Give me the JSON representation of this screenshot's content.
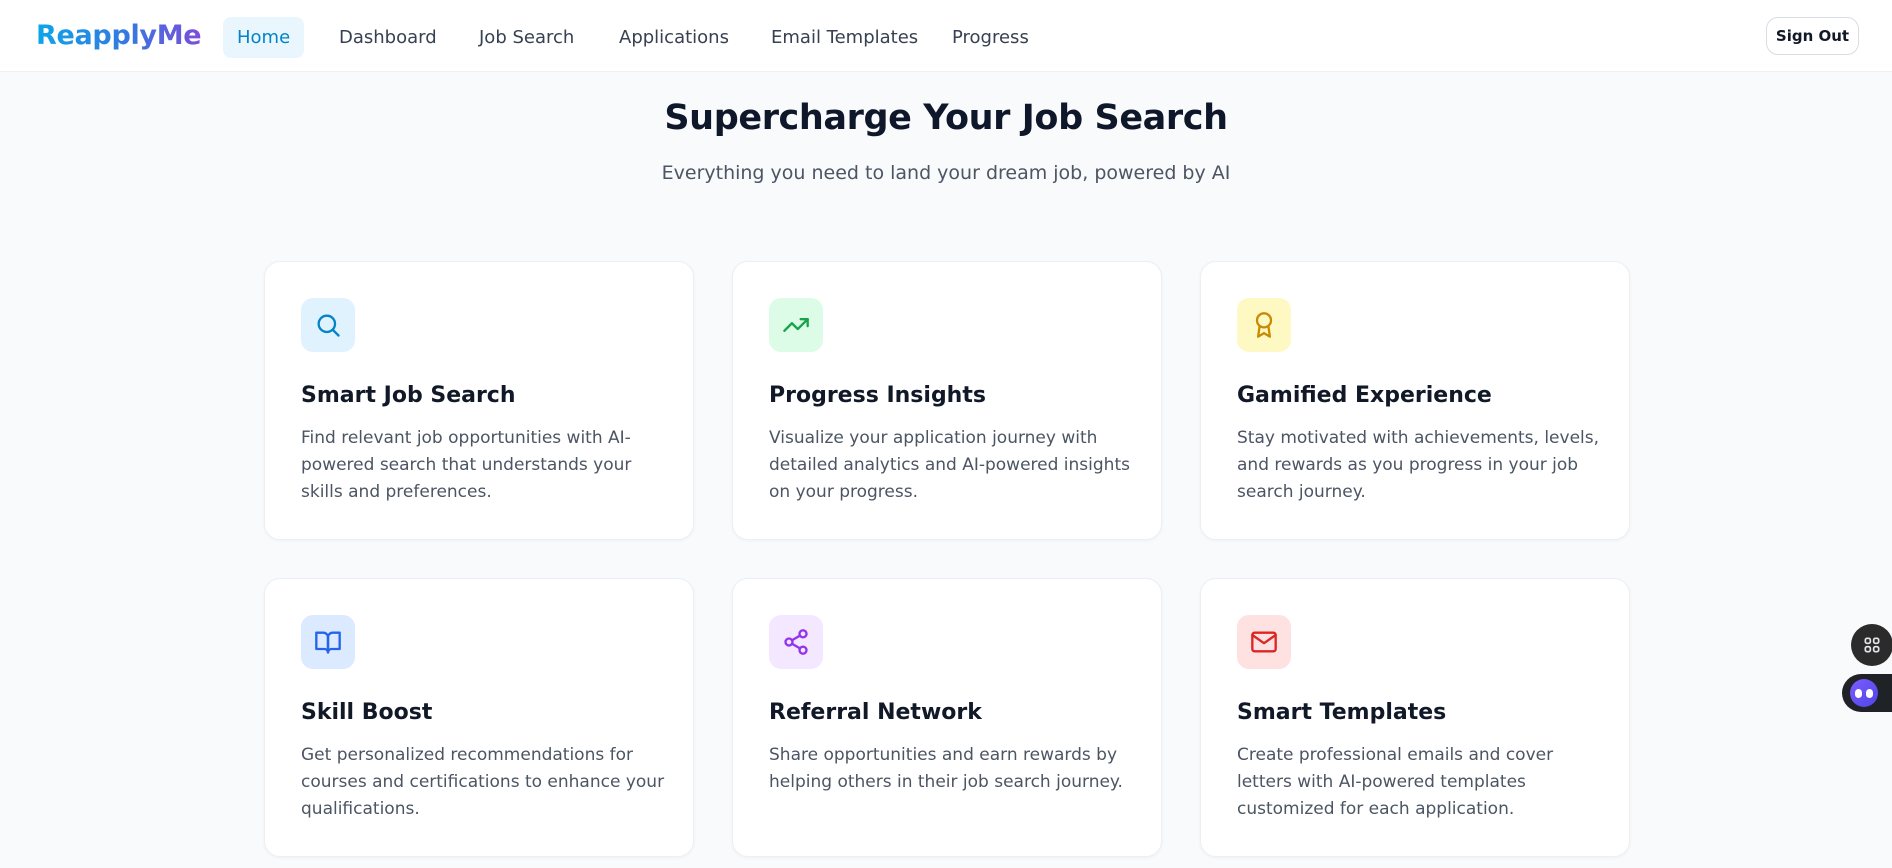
{
  "app": {
    "logo": "ReapplyMe"
  },
  "nav": {
    "items": [
      {
        "label": "Home",
        "active": true
      },
      {
        "label": "Dashboard",
        "active": false
      },
      {
        "label": "Job Search",
        "active": false
      },
      {
        "label": "Applications",
        "active": false
      },
      {
        "label": "Email Templates",
        "active": false
      },
      {
        "label": "Progress",
        "active": false
      }
    ],
    "sign_out": "Sign Out"
  },
  "hero": {
    "title": "Supercharge Your Job Search",
    "subtitle": "Everything you need to land your dream job, powered by AI"
  },
  "features": [
    {
      "title": "Smart Job Search",
      "description": "Find relevant job opportunities with AI-powered search that understands your skills and preferences.",
      "icon": "search-icon",
      "icon_bg": "#e0f2fe",
      "icon_color": "#0284c7"
    },
    {
      "title": "Progress Insights",
      "description": "Visualize your application journey with detailed analytics and AI-powered insights on your progress.",
      "icon": "trending-up-icon",
      "icon_bg": "#dcfce7",
      "icon_color": "#16a34a"
    },
    {
      "title": "Gamified Experience",
      "description": "Stay motivated with achievements, levels, and rewards as you progress in your job search journey.",
      "icon": "award-icon",
      "icon_bg": "#fef9c3",
      "icon_color": "#ca8a04"
    },
    {
      "title": "Skill Boost",
      "description": "Get personalized recommendations for courses and certifications to enhance your qualifications.",
      "icon": "book-open-icon",
      "icon_bg": "#dbeafe",
      "icon_color": "#2563eb"
    },
    {
      "title": "Referral Network",
      "description": "Share opportunities and earn rewards by helping others in their job search journey.",
      "icon": "share-icon",
      "icon_bg": "#f3e8ff",
      "icon_color": "#9333ea"
    },
    {
      "title": "Smart Templates",
      "description": "Create professional emails and cover letters with AI-powered templates customized for each application.",
      "icon": "mail-icon",
      "icon_bg": "#fee2e2",
      "icon_color": "#dc2626"
    }
  ]
}
